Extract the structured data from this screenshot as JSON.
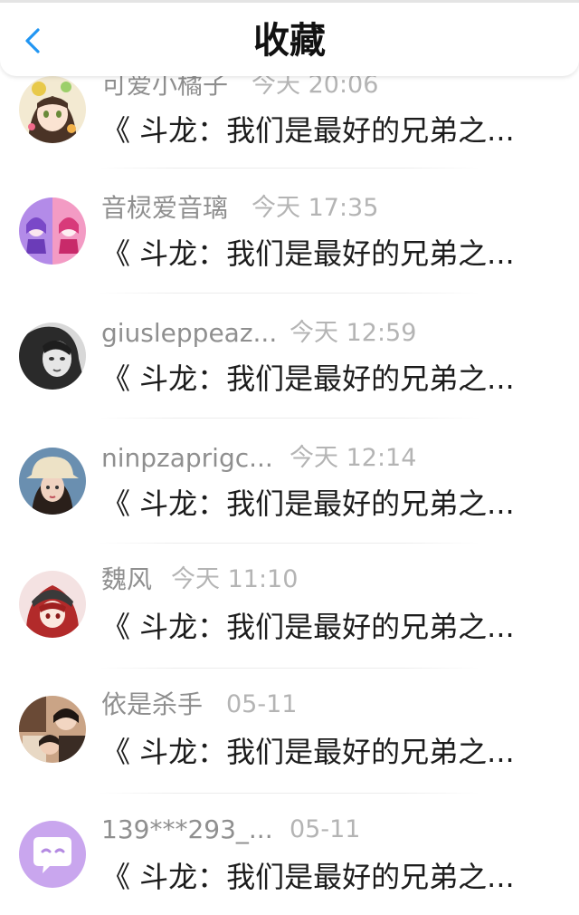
{
  "header": {
    "title": "收藏",
    "back_icon": "chevron-left-icon",
    "accent_color": "#2196f3"
  },
  "items": [
    {
      "username": "可爱小橘子",
      "time": "今天 20:06",
      "content": "《 斗龙：我们是最好的兄弟之...",
      "avatar": "anime-girl-avatar"
    },
    {
      "username": "音棂爱音璃",
      "time": "今天 17:35",
      "content": "《 斗龙：我们是最好的兄弟之...",
      "avatar": "anime-duo-avatar"
    },
    {
      "username": "giusleppeaz...",
      "time": "今天 12:59",
      "content": "《 斗龙：我们是最好的兄弟之...",
      "avatar": "grayscale-photo-avatar"
    },
    {
      "username": "ninpzaprigc...",
      "time": "今天 12:14",
      "content": "《 斗龙：我们是最好的兄弟之...",
      "avatar": "bucket-hat-photo-avatar"
    },
    {
      "username": "魏风",
      "time": "今天 11:10",
      "content": "《 斗龙：我们是最好的兄弟之...",
      "avatar": "red-hair-anime-avatar"
    },
    {
      "username": "依是杀手",
      "time": "05-11",
      "content": "《 斗龙：我们是最好的兄弟之...",
      "avatar": "group-photo-avatar"
    },
    {
      "username": "139***293_...",
      "time": "05-11",
      "content": "《 斗龙：我们是最好的兄弟之...",
      "avatar": "default-chat-avatar"
    }
  ]
}
